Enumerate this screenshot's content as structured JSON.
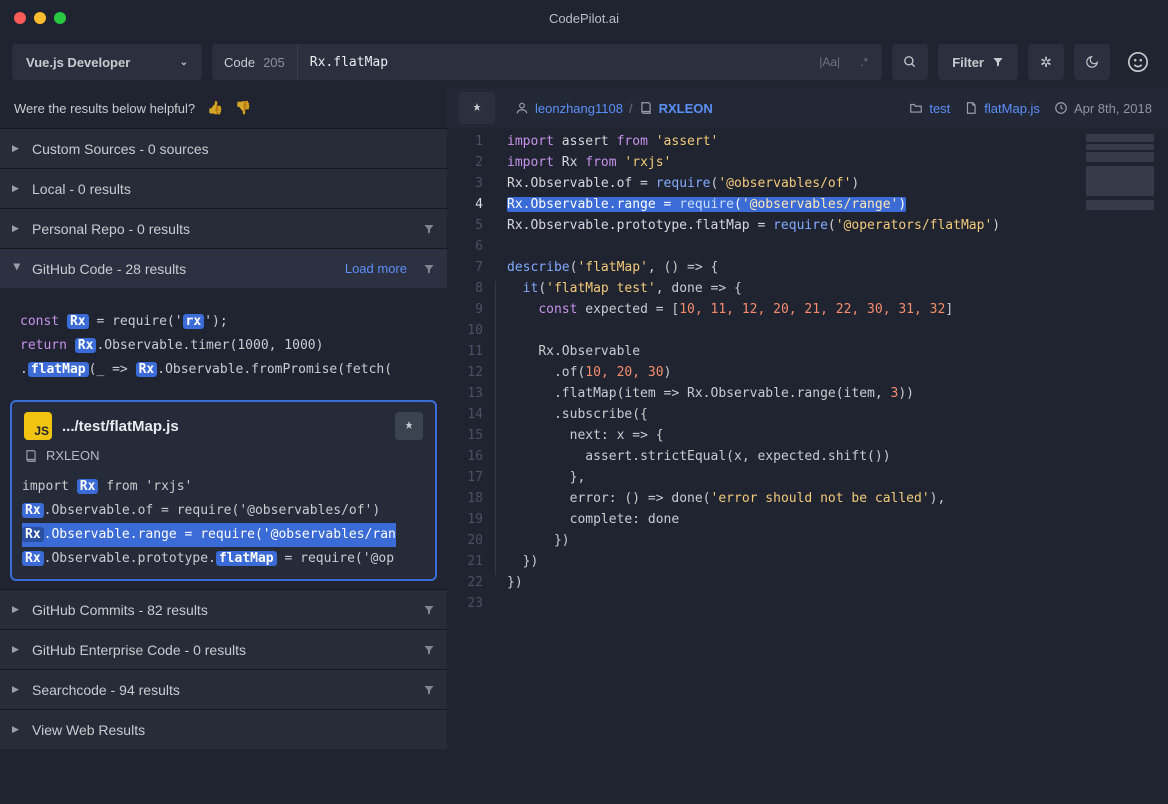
{
  "app_title": "CodePilot.ai",
  "profile": "Vue.js Developer",
  "intent": {
    "label": "Code",
    "count": "205"
  },
  "search_value": "Rx.flatMap",
  "match_case": "|Aa|",
  "regex": ".*",
  "filter_label": "Filter",
  "helpful": "Were the results below helpful?",
  "groups": {
    "custom": "Custom Sources - 0 sources",
    "local": "Local - 0 results",
    "personal": "Personal Repo - 0 results",
    "ghcode": "GitHub Code - 28 results",
    "ghcode_loadmore": "Load more",
    "ghcommits": "GitHub Commits - 82 results",
    "ghe": "GitHub Enterprise Code - 0 results",
    "searchcode": "Searchcode - 94 results",
    "web": "View Web Results"
  },
  "preview1": {
    "l1a": "const ",
    "l1rx": "Rx",
    "l1b": " = require('",
    "l1c": "rx",
    "l1d": "');",
    "l2a": "return ",
    "l2rx": "Rx",
    "l2b": ".Observable.timer(1000, 1000)",
    "l3a": ".",
    "l3fm": "flatMap",
    "l3b": "(_ => ",
    "l3rx": "Rx",
    "l3c": ".Observable.fromPromise(fetch("
  },
  "selected": {
    "js": "JS",
    "title": ".../test/flatMap.js",
    "repo": "RXLEON",
    "l1a": "import ",
    "l1rx": "Rx",
    "l1b": " from 'rxjs'",
    "l2rx": "Rx",
    "l2b": ".Observable.of = require('@observables/of')",
    "l3rx": "Rx",
    "l3b": ".Observable.range = require('@observables/ran",
    "l4rx": "Rx",
    "l4b": ".Observable.prototype.",
    "l4fm": "flatMap",
    "l4c": " = require('@op"
  },
  "crumb": {
    "user": "leonzhang1108",
    "repo": "RXLEON",
    "folder": "test",
    "file": "flatMap.js",
    "date": "Apr 8th, 2018"
  },
  "editor": {
    "lines": [
      "1",
      "2",
      "3",
      "4",
      "5",
      "6",
      "7",
      "8",
      "9",
      "10",
      "11",
      "12",
      "13",
      "14",
      "15",
      "16",
      "17",
      "18",
      "19",
      "20",
      "21",
      "22",
      "23"
    ],
    "l1": {
      "kw1": "import",
      "sp": " ",
      "id": "assert",
      "kw2": " from ",
      "str": "'assert'"
    },
    "l2": {
      "kw1": "import",
      "id": " Rx",
      "kw2": " from ",
      "str": "'rxjs'"
    },
    "l3": {
      "a": "Rx.Observable.of = ",
      "req": "require",
      "b": "(",
      "str": "'@observables/of'",
      "c": ")"
    },
    "l4": {
      "sel_a": "Rx.Observable.range = ",
      "req": "require",
      "sel_b": "(",
      "str": "'@observables/range'",
      "sel_c": ")"
    },
    "l5": {
      "a": "Rx.Observable.prototype.flatMap = ",
      "req": "require",
      "b": "(",
      "str": "'@operators/flatMap'",
      "c": ")"
    },
    "l7": {
      "fn": "describe",
      "a": "(",
      "str": "'flatMap'",
      "b": ", () => {"
    },
    "l8": {
      "pad": "  ",
      "fn": "it",
      "a": "(",
      "str": "'flatMap test'",
      "b": ", done => {"
    },
    "l9": {
      "pad": "    ",
      "kw": "const",
      "a": " expected = [",
      "n": "10, 11, 12, 20, 21, 22, 30, 31, 32",
      "b": "]"
    },
    "l11": {
      "pad": "    ",
      "a": "Rx.Observable"
    },
    "l12": {
      "pad": "      ",
      "a": ".of(",
      "n": "10, 20, 30",
      "b": ")"
    },
    "l13": {
      "pad": "      ",
      "a": ".flatMap(item => Rx.Observable.range(item, ",
      "n": "3",
      "b": "))"
    },
    "l14": {
      "pad": "      ",
      "a": ".subscribe({"
    },
    "l15": {
      "pad": "        ",
      "a": "next: x => {"
    },
    "l16": {
      "pad": "          ",
      "a": "assert.strictEqual(x, expected.shift())"
    },
    "l17": {
      "pad": "        ",
      "a": "},"
    },
    "l18": {
      "pad": "        ",
      "a": "error: () => done(",
      "str": "'error should not be called'",
      "b": "),"
    },
    "l19": {
      "pad": "        ",
      "a": "complete: done"
    },
    "l20": {
      "pad": "      ",
      "a": "})"
    },
    "l21": {
      "pad": "  ",
      "a": "})"
    },
    "l22": {
      "a": "})"
    }
  }
}
